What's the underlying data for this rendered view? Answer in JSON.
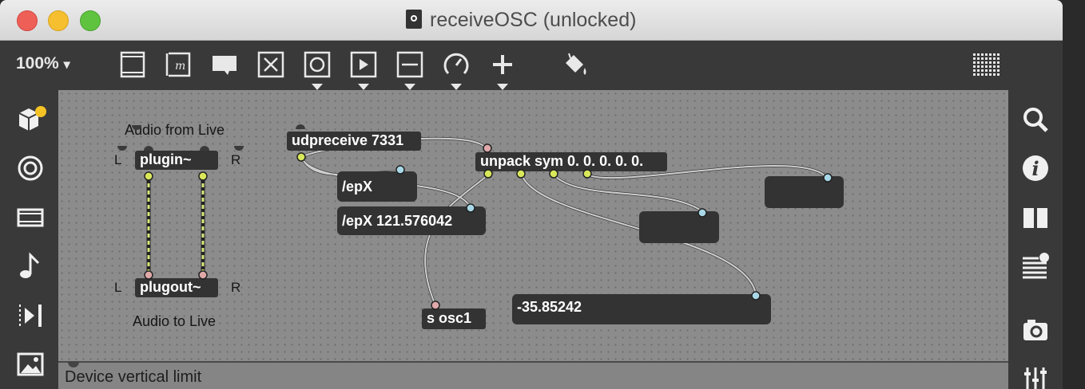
{
  "window": {
    "title": "receiveOSC (unlocked)"
  },
  "toolbar": {
    "zoom": "100%",
    "zoom_caret": "▾",
    "items": [
      "presentation-icon",
      "message-icon",
      "comment-icon",
      "toggle-icon",
      "button-icon",
      "playbar-icon",
      "slider-icon",
      "dial-icon",
      "add-icon",
      "paint-bucket-icon",
      "grid-icon"
    ]
  },
  "left_sidebar": {
    "items": [
      "package-icon",
      "target-icon",
      "film-icon",
      "note-icon",
      "step-icon",
      "image-icon"
    ]
  },
  "right_sidebar": {
    "items": [
      "search-icon",
      "info-icon",
      "book-icon",
      "list-icon",
      "camera-icon",
      "mixer-icon"
    ]
  },
  "patch": {
    "comment_audio_from": "Audio from Live",
    "comment_audio_to": "Audio to Live",
    "plugin": "plugin~",
    "plugout": "plugout~",
    "label_l1": "L",
    "label_r1": "R",
    "label_l2": "L",
    "label_r2": "R",
    "udpreceive": "udpreceive 7331",
    "unpack": "unpack sym 0. 0. 0. 0. 0.",
    "msg_epx": "/epX",
    "msg_epx_value": "/epX 121.576042",
    "send": "s osc1",
    "number_value": "-35.85242",
    "device_limit": "Device vertical limit"
  },
  "colors": {
    "canvas": "#8c8c8c",
    "object_bg": "#333333",
    "audio_cord": "#d8e87a",
    "cord": "#c8c8c8",
    "inlet_signal": "#e0a8a8",
    "inlet_control": "#a8d8e8",
    "outlet_yellow": "#d8e85a"
  }
}
